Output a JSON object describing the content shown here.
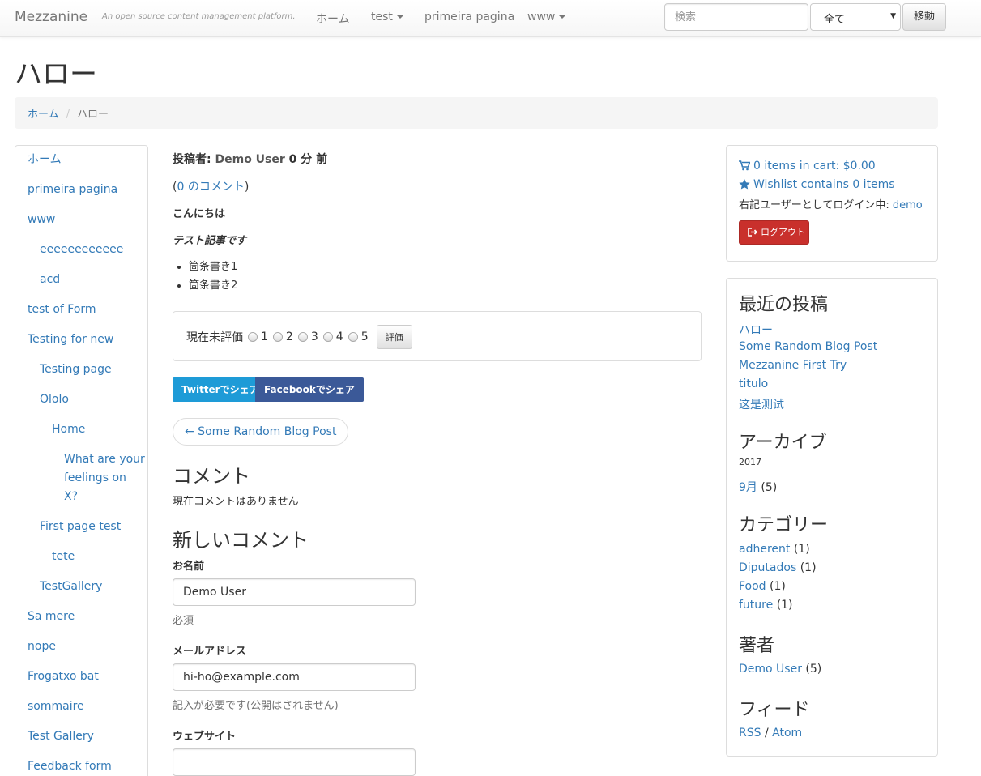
{
  "navbar": {
    "brand": "Mezzanine",
    "tagline": "An open source content management platform.",
    "links": [
      {
        "label": "ホーム",
        "dropdown": false
      },
      {
        "label": "test",
        "dropdown": true
      },
      {
        "label": "primeira pagina",
        "dropdown": false
      },
      {
        "label": "www",
        "dropdown": true
      }
    ],
    "search_placeholder": "検索",
    "search_scope": "全て",
    "search_button": "移動"
  },
  "page": {
    "title": "ハロー",
    "breadcrumb": {
      "home": "ホーム",
      "separator": "/",
      "current": "ハロー"
    }
  },
  "tree": [
    {
      "label": "ホーム"
    },
    {
      "label": "primeira pagina"
    },
    {
      "label": "www"
    },
    {
      "label": "eeeeeeeeeeee"
    },
    {
      "label": "acd"
    },
    {
      "label": "test of Form"
    },
    {
      "label": "Testing for new"
    },
    {
      "label": "Testing page"
    },
    {
      "label": "Ololo"
    },
    {
      "label": "Home"
    },
    {
      "label": "What are your"
    },
    {
      "label": "feelings on"
    },
    {
      "label": "X?"
    },
    {
      "label": "First page test"
    },
    {
      "label": "tete"
    },
    {
      "label": "TestGallery"
    },
    {
      "label": "Sa mere"
    },
    {
      "label": "nope"
    },
    {
      "label": "Frogatxo bat"
    },
    {
      "label": "sommaire"
    },
    {
      "label": "Test Gallery"
    },
    {
      "label": "Feedback form"
    }
  ],
  "post": {
    "meta_prefix": "投稿者: ",
    "author": "Demo User",
    "meta_time": " 0 分 前",
    "comments_open": "(",
    "comments_link": "0 のコメント",
    "comments_close": ")",
    "para1": "こんにちは",
    "para2": "テスト記事です",
    "bullets": [
      "箇条書き1",
      "箇条書き2"
    ]
  },
  "rating": {
    "label": "現在未評価",
    "options": [
      "1",
      "2",
      "3",
      "4",
      "5"
    ],
    "button": "評価"
  },
  "share": {
    "twitter": "Twitterでシェア",
    "facebook": "Facebookでシェア"
  },
  "prev_post": "← Some Random Blog Post",
  "comments": {
    "heading": "コメント",
    "empty": "現在コメントはありません"
  },
  "form": {
    "heading": "新しいコメント",
    "name_label": "お名前",
    "name_value": "Demo User",
    "name_help": "必須",
    "email_label": "メールアドレス",
    "email_value": "hi-ho@example.com",
    "email_help": "記入が必要です(公開はされません)",
    "website_label": "ウェブサイト",
    "website_value": ""
  },
  "account": {
    "cart": "0 items in cart: $0.00",
    "wishlist": "Wishlist contains 0 items",
    "login_text": "右記ユーザーとしてログイン中: ",
    "login_user": "demo",
    "logout": "ログアウト"
  },
  "sidebar": {
    "recent_heading": "最近の投稿",
    "recent_posts": [
      "ハロー",
      "Some Random Blog Post",
      "Mezzanine First Try",
      "titulo",
      "这是测试"
    ],
    "archive_heading": "アーカイブ",
    "archive_year": "2017",
    "archive_month": "9月",
    "archive_count": "(5)",
    "categories_heading": "カテゴリー",
    "categories": [
      {
        "name": "adherent",
        "count": "(1)"
      },
      {
        "name": "Diputados",
        "count": "(1)"
      },
      {
        "name": "Food",
        "count": "(1)"
      },
      {
        "name": "future",
        "count": "(1)"
      }
    ],
    "authors_heading": "著者",
    "author_name": "Demo User",
    "author_count": "(5)",
    "feeds_heading": "フィード",
    "feed_rss": "RSS",
    "feed_sep": " / ",
    "feed_atom": "Atom"
  }
}
